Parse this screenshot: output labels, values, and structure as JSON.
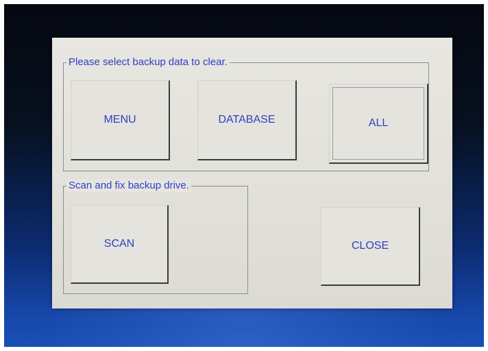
{
  "dialog": {
    "clear_group": {
      "title": "Please select backup data to clear.",
      "buttons": {
        "menu": "MENU",
        "database": "DATABASE",
        "all": "ALL"
      }
    },
    "scan_group": {
      "title": "Scan and fix backup drive.",
      "buttons": {
        "scan": "SCAN"
      }
    },
    "close_label": "CLOSE"
  },
  "colors": {
    "label_text": "#2f3fc4",
    "dialog_bg": "#e4e3dd",
    "screen_bg": "#0c2a6e"
  }
}
